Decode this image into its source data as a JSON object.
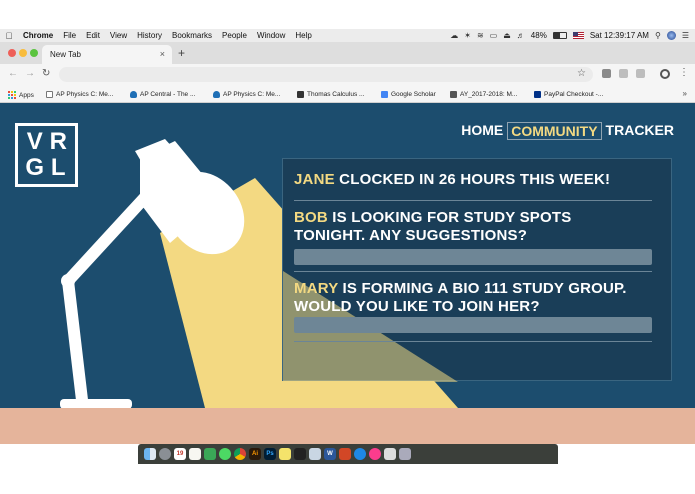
{
  "menubar": {
    "items": [
      "Chrome",
      "File",
      "Edit",
      "View",
      "History",
      "Bookmarks",
      "People",
      "Window",
      "Help"
    ],
    "battery": "48%",
    "clock": "Sat 12:39:17 AM"
  },
  "browser": {
    "tab_title": "New Tab",
    "tab_close": "×",
    "new_tab": "+",
    "omnibox_value": "",
    "bookmarks": [
      {
        "label": "Apps",
        "color": "#e74c3c"
      },
      {
        "label": "AP Physics C: Me...",
        "color": "#777777"
      },
      {
        "label": "AP Central - The ...",
        "color": "#1f6fb5"
      },
      {
        "label": "AP Physics C: Me...",
        "color": "#1f6fb5"
      },
      {
        "label": "Thomas Calculus ...",
        "color": "#333333"
      },
      {
        "label": "Google Scholar",
        "color": "#4285f4"
      },
      {
        "label": "AY_2017-2018: M...",
        "color": "#555555"
      },
      {
        "label": "PayPal Checkout -...",
        "color": "#003087"
      }
    ],
    "bookmarks_more": "»"
  },
  "site": {
    "logo": [
      "V",
      "R",
      "G",
      "L"
    ],
    "nav": [
      {
        "label": "HOME",
        "active": false
      },
      {
        "label": "COMMUNITY",
        "active": true
      },
      {
        "label": "TRACKER",
        "active": false
      }
    ],
    "posts": [
      {
        "name": "JANE",
        "text": " CLOCKED IN  26 HOURS THIS WEEK!",
        "line2": ""
      },
      {
        "name": "BOB",
        "text": " IS LOOKING FOR STUDY SPOTS",
        "line2": "TONIGHT. ANY SUGGESTIONS?"
      },
      {
        "name": "MARY",
        "text": " IS FORMING A BIO 111 STUDY GROUP.",
        "line2": "WOULD YOU LIKE TO JOIN HER?"
      }
    ],
    "colors": {
      "background": "#1c4d6e",
      "accent": "#f3d982",
      "floor": "#e5b49b",
      "lamp": "#ffffff"
    }
  },
  "dock": {
    "apps": [
      "finder-icon",
      "launchpad-icon",
      "calendar-icon",
      "notes-icon",
      "facetime-icon",
      "messages-icon",
      "chrome-icon",
      "illustrator-icon",
      "photoshop-icon",
      "stickies-icon",
      "terminal-icon",
      "preview-icon",
      "word-icon",
      "powerpoint-icon",
      "safari-icon",
      "itunes-icon",
      "photos-icon",
      "trash-icon"
    ],
    "calendar_day": "19",
    "illustrator_label": "Ai",
    "photoshop_label": "Ps",
    "word_label": "W"
  }
}
